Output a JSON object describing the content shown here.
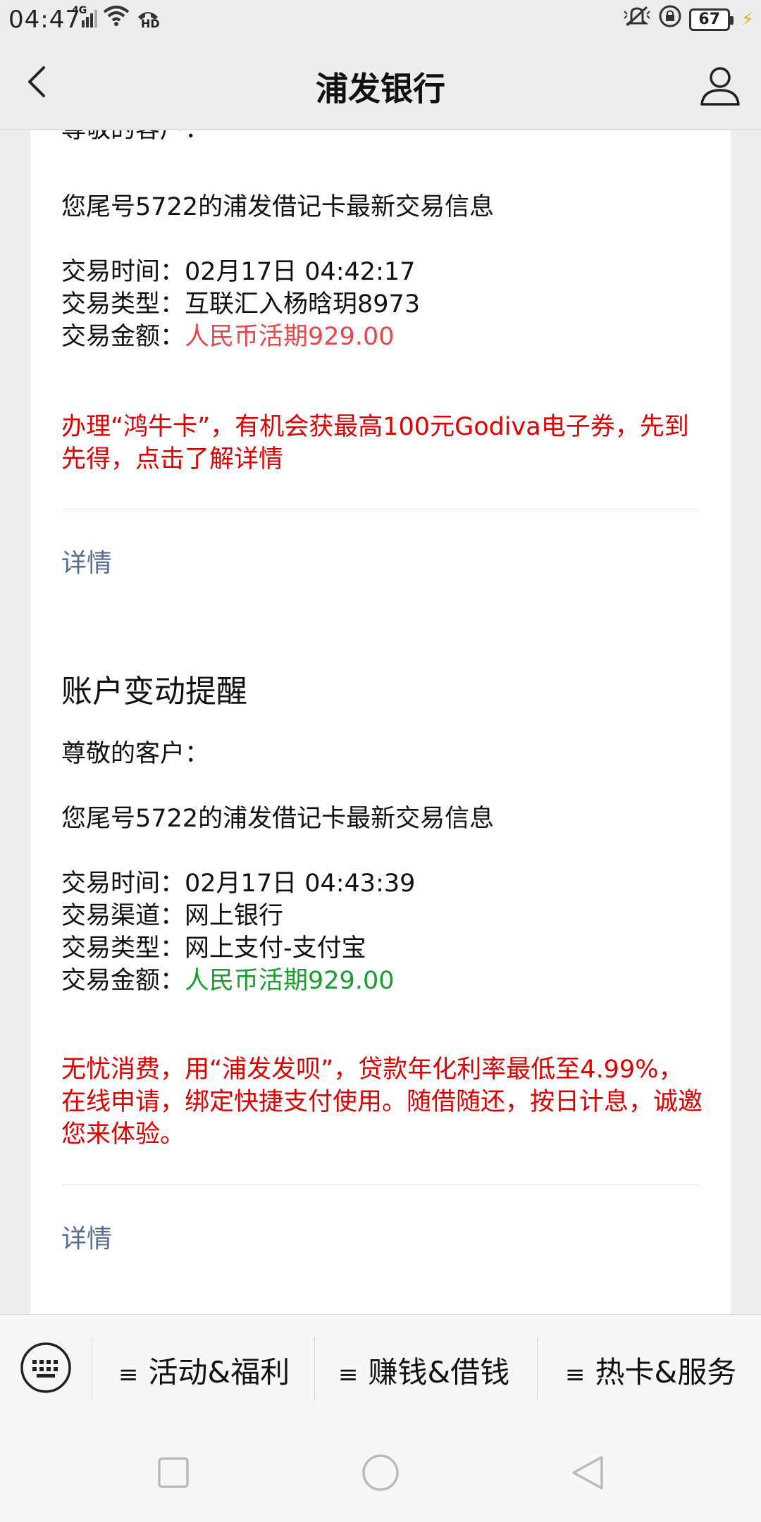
{
  "status_bar": {
    "time": "04:47",
    "network": "4G",
    "hd_label": "HD",
    "battery_level": "67"
  },
  "nav": {
    "title": "浦发银行"
  },
  "cards": [
    {
      "greeting": "尊敬的客户：",
      "summary": "您尾号5722的浦发借记卡最新交易信息",
      "time_label": "交易时间：",
      "time_value": "02月17日  04:42:17",
      "type_label": "交易类型：",
      "type_value": "互联汇入杨晗玥8973",
      "amount_label": "交易金额：",
      "amount_value": "人民币活期929.00",
      "promo": "办理“鸿牛卡”，有机会获最高100元Godiva电子券，先到先得，点击了解详情",
      "detail": "详情"
    },
    {
      "title": "账户变动提醒",
      "greeting": "尊敬的客户：",
      "summary": "您尾号5722的浦发借记卡最新交易信息",
      "time_label": "交易时间：",
      "time_value": "02月17日  04:43:39",
      "channel_label": "交易渠道：",
      "channel_value": "网上银行",
      "type_label": "交易类型：",
      "type_value": "网上支付-支付宝",
      "amount_label": "交易金额：",
      "amount_value": "人民币活期929.00",
      "promo": "无忧消费，用“浦发发呗”，贷款年化利率最低至4.99%，在线申请，绑定快捷支付使用。随借随还，按日计息，诚邀您来体验。",
      "detail": "详情"
    }
  ],
  "bottom_menu": {
    "items": [
      {
        "label": "活动&福利"
      },
      {
        "label": "赚钱&借钱"
      },
      {
        "label": "热卡&服务"
      }
    ],
    "menu_glyph": "≡"
  },
  "colors": {
    "accent_link": "#576b95",
    "promo_red": "#e00000",
    "amount_red": "#e5484d",
    "amount_green": "#1a9c2f"
  },
  "icons": {
    "back": "chevron-left-icon",
    "user": "user-icon",
    "keyboard": "keyboard-icon"
  }
}
